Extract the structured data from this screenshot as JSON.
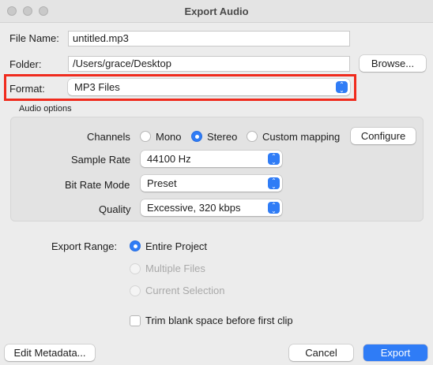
{
  "window": {
    "title": "Export Audio"
  },
  "file": {
    "name_label": "File Name:",
    "name_value": "untitled.mp3"
  },
  "folder": {
    "label": "Folder:",
    "value": "/Users/grace/Desktop",
    "browse_label": "Browse..."
  },
  "format": {
    "label": "Format:",
    "value": "MP3 Files"
  },
  "audio_options": {
    "title": "Audio options",
    "channels": {
      "label": "Channels",
      "options": [
        "Mono",
        "Stereo",
        "Custom mapping"
      ],
      "selected": "Stereo",
      "configure_label": "Configure"
    },
    "sample_rate": {
      "label": "Sample Rate",
      "value": "44100 Hz"
    },
    "bit_rate_mode": {
      "label": "Bit Rate Mode",
      "value": "Preset"
    },
    "quality": {
      "label": "Quality",
      "value": "Excessive, 320 kbps"
    }
  },
  "export_range": {
    "label": "Export Range:",
    "options": [
      "Entire Project",
      "Multiple Files",
      "Current Selection"
    ],
    "selected": "Entire Project"
  },
  "trim": {
    "label": "Trim blank space before first clip",
    "checked": false
  },
  "footer": {
    "edit_metadata": "Edit Metadata...",
    "cancel": "Cancel",
    "export": "Export"
  },
  "colors": {
    "accent": "#2f7cf6",
    "highlight": "#f02b1d"
  }
}
